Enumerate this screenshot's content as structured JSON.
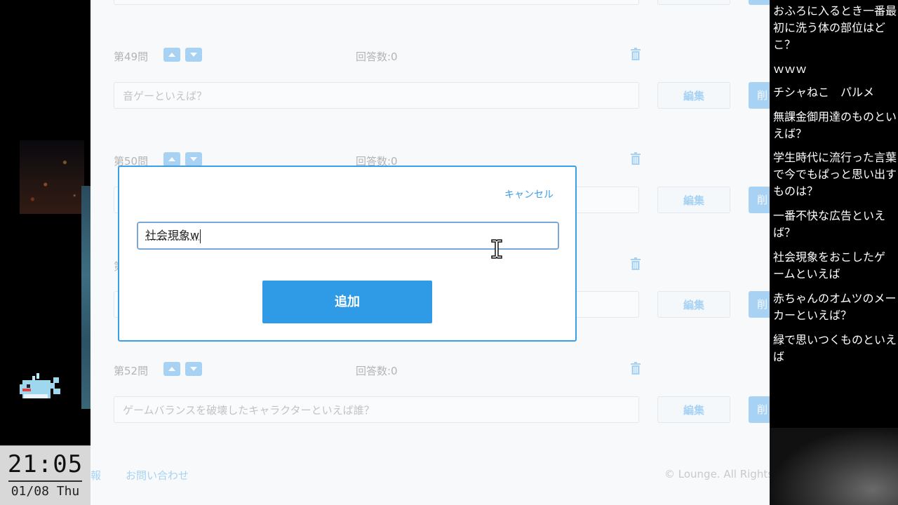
{
  "clock": {
    "time": "21:05",
    "date": "01/08 Thu"
  },
  "questions": [
    {
      "number": "第49問",
      "answers": "回答数:0",
      "text": "音ゲーといえば？",
      "edit_label": "編集",
      "side_label": "削"
    },
    {
      "number": "第50問",
      "answers": "回答数:0",
      "text": "",
      "edit_label": "編集",
      "side_label": "削"
    },
    {
      "number": "第",
      "answers": "",
      "text": "",
      "edit_label": "編集",
      "side_label": "削"
    },
    {
      "number": "第52問",
      "answers": "回答数:0",
      "text": "ゲームバランスを破壊したキャラクターといえば誰？",
      "edit_label": "編集",
      "side_label": "削"
    }
  ],
  "top_row": {
    "edit_label": ""
  },
  "footer": {
    "link_left": "報",
    "contact": "お問い合わせ",
    "copyright": "© Lounge. All Rights"
  },
  "modal": {
    "cancel": "キャンセル",
    "input_value": "社会現象w",
    "add_button": "追加"
  },
  "comments": [
    "おふろに入るとき一番最初に洗う体の部位はどこ？",
    "ｗｗｗ",
    "チシャねこ　パルメ",
    "無課金御用達のものといえば？",
    "学生時代に流行った言葉で今でもぱっと思い出すものは？",
    "一番不快な広告といえば？",
    "社会現象をおこしたゲームといえば",
    "赤ちゃんのオムツのメーカーといえば？",
    "緑で思いつくものといえば"
  ],
  "colors": {
    "accent": "#3a9ee8",
    "page_bg": "#f7f9fb",
    "modal_border": "#3a9ee8"
  }
}
